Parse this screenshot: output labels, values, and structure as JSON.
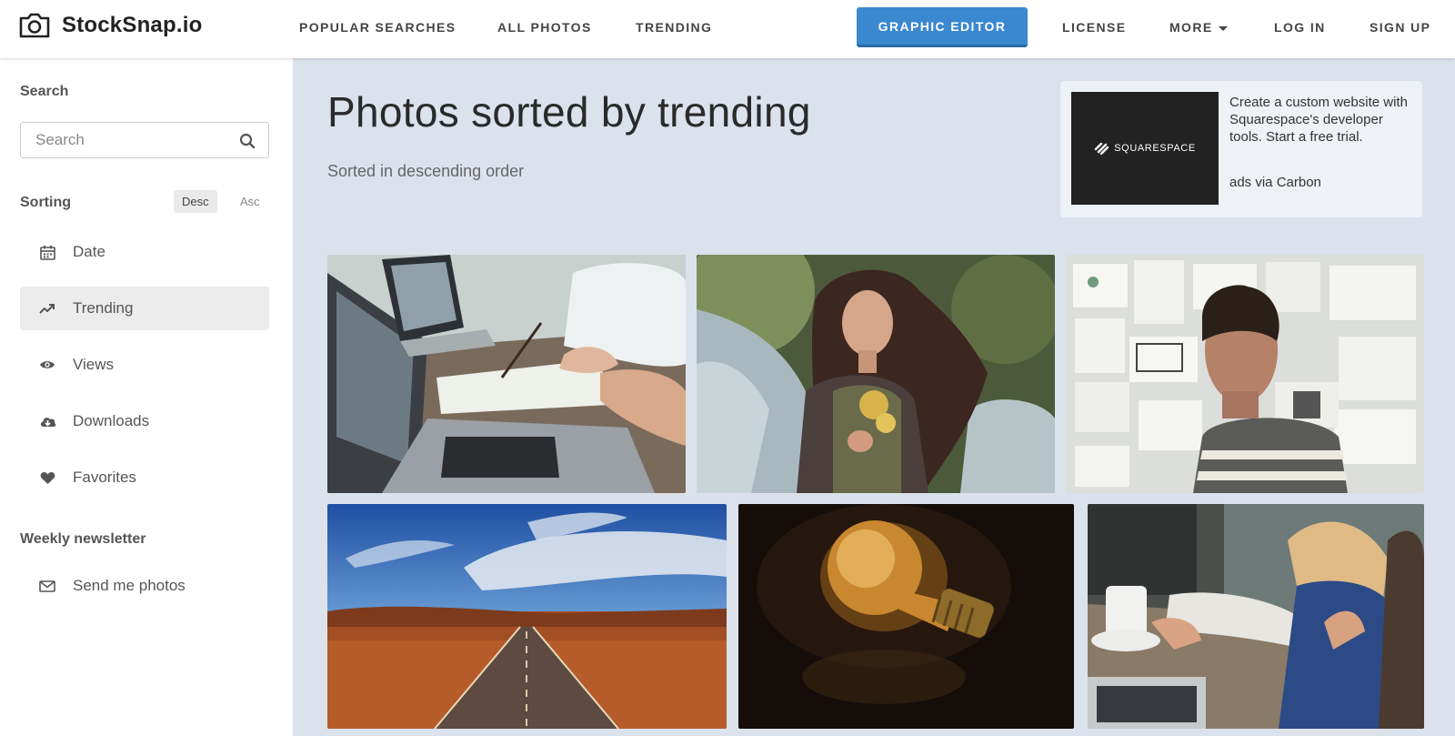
{
  "brand": {
    "name": "StockSnap.io"
  },
  "nav": {
    "popular": "POPULAR SEARCHES",
    "all_photos": "ALL PHOTOS",
    "trending": "TRENDING",
    "graphic_editor": "GRAPHIC EDITOR",
    "license": "LICENSE",
    "more": "MORE",
    "login": "LOG IN",
    "signup": "SIGN UP"
  },
  "sidebar": {
    "search_heading": "Search",
    "search_placeholder": "Search",
    "sorting_heading": "Sorting",
    "desc": "Desc",
    "asc": "Asc",
    "items": [
      {
        "label": "Date",
        "icon": "calendar-icon"
      },
      {
        "label": "Trending",
        "icon": "trending-icon",
        "active": true
      },
      {
        "label": "Views",
        "icon": "eye-icon"
      },
      {
        "label": "Downloads",
        "icon": "cloud-download-icon"
      },
      {
        "label": "Favorites",
        "icon": "heart-icon"
      }
    ],
    "newsletter_heading": "Weekly newsletter",
    "newsletter_item": {
      "label": "Send me photos",
      "icon": "envelope-icon"
    }
  },
  "main": {
    "title": "Photos sorted by trending",
    "subtitle": "Sorted in descending order"
  },
  "ad": {
    "brand": "SQUARESPACE",
    "text": "Create a custom website with Squarespace's developer tools. Start a free trial.",
    "via": "ads via Carbon"
  },
  "colors": {
    "accent": "#3a88d0",
    "page_bg": "#dbe2ec"
  }
}
